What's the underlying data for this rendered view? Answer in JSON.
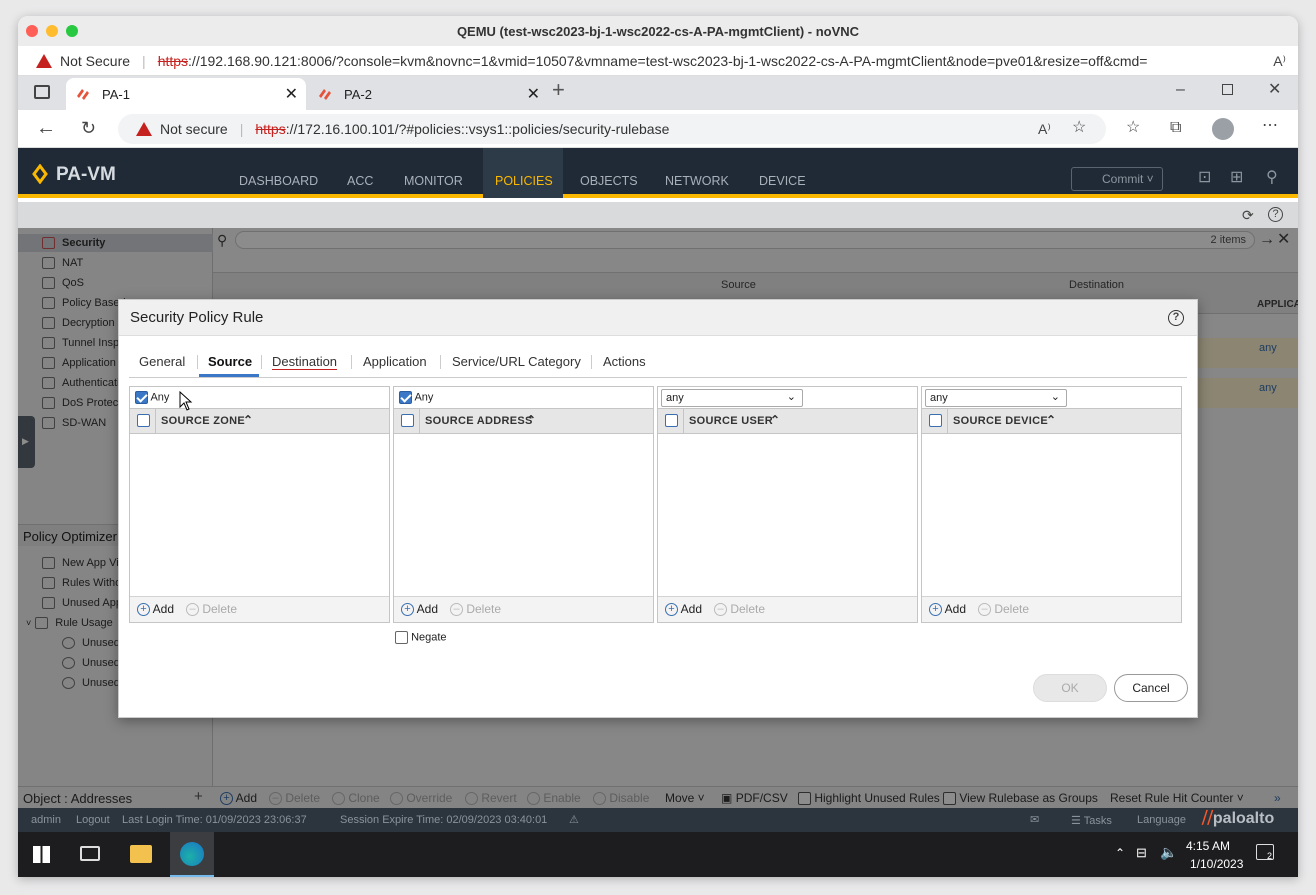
{
  "mac": {
    "title": "QEMU (test-wsc2023-bj-1-wsc2022-cs-A-PA-mgmtClient) - noVNC",
    "not_secure": "Not Secure",
    "url_https": "https",
    "url_rest": "://192.168.90.121:8006/?console=kvm&novnc=1&vmid=10507&vmname=test-wsc2023-bj-1-wsc2022-cs-A-PA-mgmtClient&node=pve01&resize=off&cmd="
  },
  "edge": {
    "tabs": [
      {
        "label": "PA-1"
      },
      {
        "label": "PA-2"
      }
    ],
    "not_secure": "Not secure",
    "url_https": "https",
    "url_rest": "://172.16.100.101/?#policies::vsys1::policies/security-rulebase"
  },
  "pa": {
    "logo": "PA-VM",
    "nav": [
      "DASHBOARD",
      "ACC",
      "MONITOR",
      "POLICIES",
      "OBJECTS",
      "NETWORK",
      "DEVICE"
    ],
    "commit": "Commit",
    "items_count": "2 items",
    "col_source": "Source",
    "col_destination": "Destination",
    "col_application": "APPLICA",
    "any1": "any",
    "any2": "any",
    "sidebar": [
      "Security",
      "NAT",
      "QoS",
      "Policy Based",
      "Decryption",
      "Tunnel Insp",
      "Application",
      "Authenticati",
      "DoS Protect",
      "SD-WAN"
    ],
    "optimizer_title": "Policy Optimizer",
    "optimizer": [
      "New App Vi",
      "Rules Witho",
      "Unused App",
      "Rule Usage",
      "Unused",
      "Unused",
      "Unused"
    ],
    "object_addresses": "Object : Addresses",
    "bottom": {
      "add": "Add",
      "delete": "Delete",
      "clone": "Clone",
      "override": "Override",
      "revert": "Revert",
      "enable": "Enable",
      "disable": "Disable",
      "move": "Move",
      "pdf": "PDF/CSV",
      "highlight": "Highlight Unused Rules",
      "view_groups": "View Rulebase as Groups",
      "reset": "Reset Rule Hit Counter"
    },
    "status": {
      "admin": "admin",
      "logout": "Logout",
      "last_login": "Last Login Time: 01/09/2023 23:06:37",
      "session": "Session Expire Time: 02/09/2023 03:40:01",
      "tasks": "Tasks",
      "language": "Language",
      "brand": "paloalto"
    }
  },
  "dialog": {
    "title": "Security Policy Rule",
    "tabs": [
      "General",
      "Source",
      "Destination",
      "Application",
      "Service/URL Category",
      "Actions"
    ],
    "panels": [
      {
        "header": "SOURCE ZONE",
        "any_label": "Any"
      },
      {
        "header": "SOURCE ADDRESS",
        "any_label": "Any"
      },
      {
        "header": "SOURCE USER",
        "select": "any"
      },
      {
        "header": "SOURCE DEVICE",
        "select": "any"
      }
    ],
    "add": "Add",
    "delete": "Delete",
    "negate": "Negate",
    "ok": "OK",
    "cancel": "Cancel"
  },
  "taskbar": {
    "time": "4:15 AM",
    "date": "1/10/2023",
    "notif": "2"
  }
}
